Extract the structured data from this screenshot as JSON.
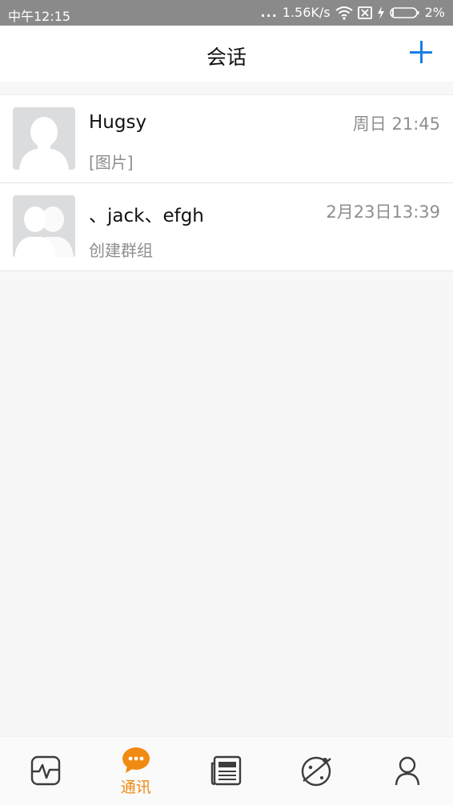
{
  "status_bar": {
    "time": "中午12:15",
    "dots": "...",
    "speed": "1.56K/s",
    "battery_pct": "2%"
  },
  "header": {
    "title": "会话",
    "add_icon": "plus-icon"
  },
  "conversations": [
    {
      "name": "Hugsy",
      "time": "周日 21:45",
      "message": "[图片]",
      "avatar_icon": "single-user-avatar-icon"
    },
    {
      "name": "、jack、efgh",
      "time": "2月23日13:39",
      "message": "创建群组",
      "avatar_icon": "group-avatar-icon"
    }
  ],
  "tabbar": {
    "tabs": [
      {
        "icon": "activity-icon",
        "label": ""
      },
      {
        "icon": "chat-bubble-icon",
        "label": "通讯",
        "active": true
      },
      {
        "icon": "news-icon",
        "label": ""
      },
      {
        "icon": "planet-icon",
        "label": ""
      },
      {
        "icon": "profile-icon",
        "label": ""
      }
    ],
    "active_color": "#f08a12",
    "inactive_color": "#3c3c3c"
  },
  "colors": {
    "accent_blue": "#1a7ee6",
    "status_bar_bg": "#8a8a8a"
  }
}
